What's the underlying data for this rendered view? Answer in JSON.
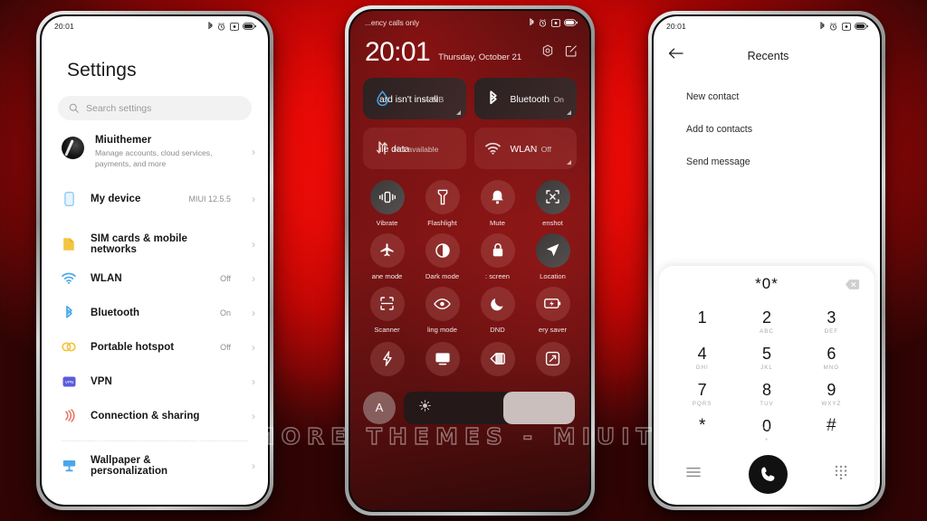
{
  "watermark": "VISIT FOR MORE THEMES - MIUITHEMER.COM",
  "statusbar": {
    "time": "20:01",
    "icons": [
      "bluetooth-icon",
      "alarm-icon",
      "dnd-icon",
      "battery-icon"
    ]
  },
  "settings_phone": {
    "title": "Settings",
    "search": {
      "placeholder": "Search settings",
      "icon": "search-icon"
    },
    "account": {
      "name": "Miuithemer",
      "subtitle": "Manage accounts, cloud services, payments, and more",
      "avatar": "account-avatar"
    },
    "rows": [
      {
        "label": "My device",
        "value": "MIUI 12.5.5",
        "icon": "device-icon",
        "color": "#7bc5f0"
      },
      {
        "label": "SIM cards & mobile networks",
        "value": "",
        "icon": "sim-icon",
        "color": "#f4c542"
      },
      {
        "label": "WLAN",
        "value": "Off",
        "icon": "wifi-icon",
        "color": "#4aa8e8"
      },
      {
        "label": "Bluetooth",
        "value": "On",
        "icon": "bluetooth-icon",
        "color": "#4aa8e8"
      },
      {
        "label": "Portable hotspot",
        "value": "Off",
        "icon": "hotspot-icon",
        "color": "#f4c542"
      },
      {
        "label": "VPN",
        "value": "",
        "icon": "vpn-icon",
        "color": "#5b5bdc"
      },
      {
        "label": "Connection & sharing",
        "value": "",
        "icon": "sharing-icon",
        "color": "#e8705c"
      },
      {
        "label": "Wallpaper & personalization",
        "value": "",
        "icon": "wallpaper-icon",
        "color": "#4aa8e8"
      }
    ]
  },
  "control_center": {
    "carrier": "...ency calls only",
    "time": "20:01",
    "date": "Thursday, October 21",
    "header_icons": [
      "settings-gear-icon",
      "edit-icon"
    ],
    "tiles": [
      {
        "name": "ard isn't install",
        "sub": "--- MB",
        "icon": "water-drop-icon",
        "state": "dark"
      },
      {
        "name": "Bluetooth",
        "sub": "On",
        "icon": "bluetooth-icon",
        "state": "dark"
      },
      {
        "name": "ile data",
        "sub": "Not available",
        "icon": "mobile-data-icon",
        "state": "red"
      },
      {
        "name": "WLAN",
        "sub": "Off",
        "icon": "wifi-icon",
        "state": "red"
      }
    ],
    "toggles": [
      {
        "label": "Vibrate",
        "icon": "vibrate-icon",
        "on": true
      },
      {
        "label": "Flashlight",
        "icon": "flashlight-icon",
        "on": false
      },
      {
        "label": "Mute",
        "icon": "bell-icon",
        "on": false
      },
      {
        "label": "enshot",
        "icon": "screenshot-icon",
        "on": true
      },
      {
        "label": "ane mode",
        "icon": "airplane-icon",
        "on": false
      },
      {
        "label": "Dark mode",
        "icon": "dark-mode-icon",
        "on": false
      },
      {
        "label": ": screen",
        "icon": "lock-icon",
        "on": false
      },
      {
        "label": "Location",
        "icon": "location-icon",
        "on": true
      },
      {
        "label": "Scanner",
        "icon": "scanner-icon",
        "on": false
      },
      {
        "label": "ling mode",
        "icon": "reading-mode-icon",
        "on": false
      },
      {
        "label": "DND",
        "icon": "moon-icon",
        "on": false
      },
      {
        "label": "ery saver",
        "icon": "battery-saver-icon",
        "on": false
      },
      {
        "label": "",
        "icon": "quick-ball-icon",
        "on": false
      },
      {
        "label": "",
        "icon": "cast-icon",
        "on": false
      },
      {
        "label": "",
        "icon": "theme-icon",
        "on": false
      },
      {
        "label": "",
        "icon": "rotate-icon",
        "on": false
      }
    ],
    "brightness": {
      "auto_label": "A",
      "icon": "sun-icon",
      "level_percent": 58
    }
  },
  "dialer_phone": {
    "back_icon": "back-arrow-icon",
    "title": "Recents",
    "menu": [
      "New contact",
      "Add to contacts",
      "Send message"
    ],
    "number": "*0*",
    "backspace_icon": "backspace-icon",
    "keys": [
      {
        "digit": "1",
        "letters": ""
      },
      {
        "digit": "2",
        "letters": "ABC"
      },
      {
        "digit": "3",
        "letters": "DEF"
      },
      {
        "digit": "4",
        "letters": "GHI"
      },
      {
        "digit": "5",
        "letters": "JKL"
      },
      {
        "digit": "6",
        "letters": "MNO"
      },
      {
        "digit": "7",
        "letters": "PQRS"
      },
      {
        "digit": "8",
        "letters": "TUV"
      },
      {
        "digit": "9",
        "letters": "WXYZ"
      },
      {
        "digit": "*",
        "letters": ""
      },
      {
        "digit": "0",
        "letters": "+"
      },
      {
        "digit": "#",
        "letters": ""
      }
    ],
    "bottom": {
      "menu_icon": "hamburger-menu-icon",
      "call_icon": "call-icon",
      "keypad_icon": "keypad-icon"
    }
  }
}
